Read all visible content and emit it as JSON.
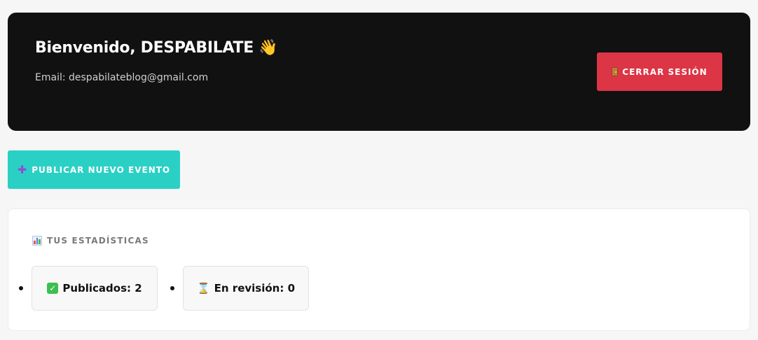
{
  "header": {
    "greeting": "Bienvenido, DESPABILATE",
    "wave_emoji": "👋",
    "email_line": "Email: despabilateblog@gmail.com",
    "logout_label": "CERRAR SESIÓN",
    "logout_icon": "door-icon"
  },
  "actions": {
    "publish_label": "PUBLICAR NUEVO EVENTO",
    "publish_icon": "plus-icon"
  },
  "stats": {
    "title": "TUS ESTADÍSTICAS",
    "title_icon": "bar-chart-icon",
    "items": [
      {
        "label": "Publicados: 2",
        "icon": "check-mark-icon"
      },
      {
        "label": "En revisión: 0",
        "icon": "hourglass-icon"
      }
    ]
  },
  "colors": {
    "background": "#f6f6f6",
    "header_bg": "#111111",
    "logout_bg": "#dc3545",
    "publish_bg": "#2bd0c5",
    "card_bg": "#ffffff"
  }
}
